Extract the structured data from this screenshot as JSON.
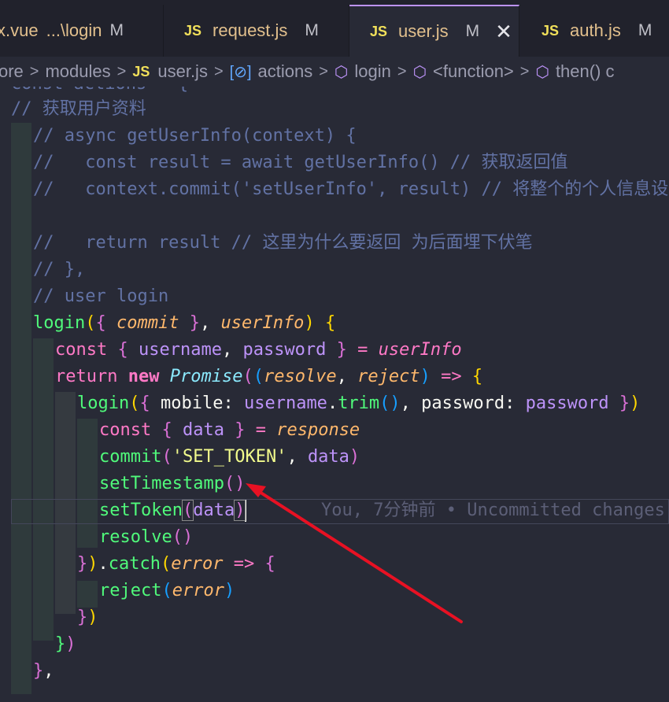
{
  "tabs": [
    {
      "name": "x.vue",
      "path": "...\\login",
      "badge": "M"
    },
    {
      "icon": "JS",
      "name": "request.js",
      "badge": "M"
    },
    {
      "icon": "JS",
      "name": "user.js",
      "badge": "M",
      "close": "✕"
    },
    {
      "icon": "JS",
      "name": "auth.js",
      "badge": "M"
    }
  ],
  "breadcrumb": {
    "items": [
      "ore",
      "modules",
      "user.js",
      "actions",
      "login",
      "<function>",
      "then() c"
    ],
    "js_icon": "JS"
  },
  "code": {
    "l0": "const actions = {",
    "l1": "// 获取用户资料",
    "l2": "// async getUserInfo(context) {",
    "l3": "//   const result = await getUserInfo() // 获取返回值",
    "l4": "//   context.commit('setUserInfo', result) // 将整个的个人信息设置到用户的vuex数据中",
    "l5": "//   return result // 这里为什么要返回 为后面埋下伏笔",
    "l6": "// },",
    "l7": "// user login",
    "login": "login",
    "commit": "commit",
    "userInfo": "userInfo",
    "const": "const",
    "username": "username",
    "password": "password",
    "return": "return",
    "new": "new",
    "Promise": "Promise",
    "resolve": "resolve",
    "reject": "reject",
    "mobile": "mobile",
    "trim": "trim",
    "data": "data",
    "response": "response",
    "set_token": "'SET_TOKEN'",
    "setTimestamp": "setTimestamp",
    "setToken": "setToken",
    "catch": "catch",
    "error": "error"
  },
  "blame": "You, 7分钟前 • Uncommitted changes",
  "colors": {
    "arrow": "#e81123",
    "accent": "#bd93f9"
  }
}
